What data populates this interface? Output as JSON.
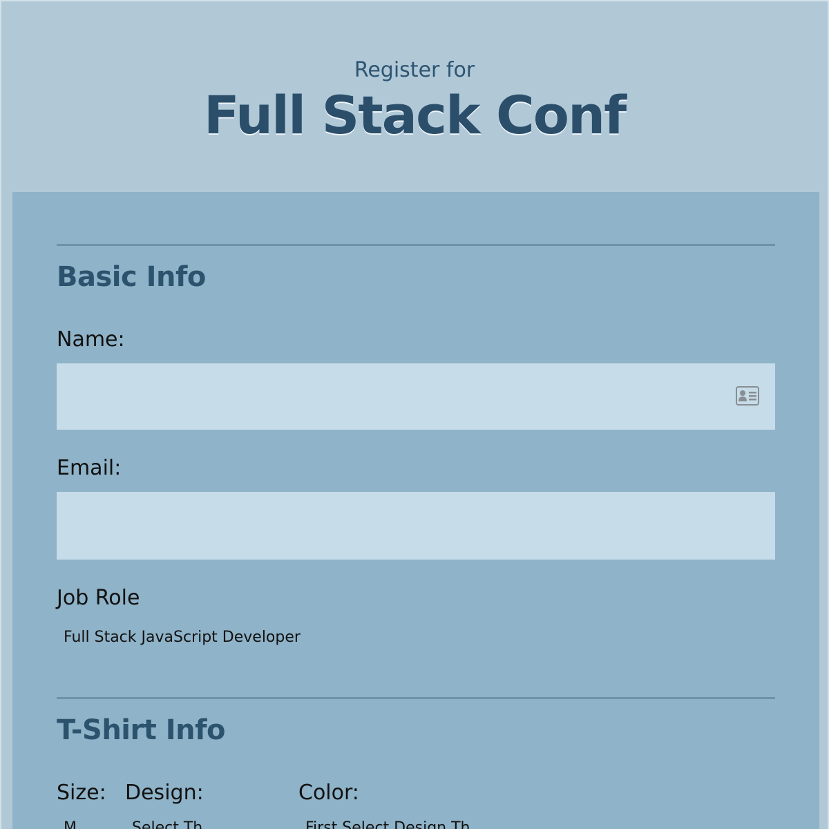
{
  "header": {
    "subtitle": "Register for",
    "title": "Full Stack Conf"
  },
  "basic_info": {
    "heading": "Basic Info",
    "name_label": "Name:",
    "name_value": "",
    "name_icon": "contact-card-icon",
    "email_label": "Email:",
    "email_value": "",
    "job_role_label": "Job Role",
    "job_role_selected": "Full Stack JavaScript Developer"
  },
  "tshirt_info": {
    "heading": "T-Shirt Info",
    "size_label": "Size:",
    "design_label": "Design:",
    "color_label": "Color:",
    "size_value": "M",
    "design_value": "Select Th",
    "color_value": "First Select Design Th"
  },
  "colors": {
    "page_bg": "#b1c8d7",
    "card_bg": "#8fb3c8",
    "input_bg": "#c6dce9",
    "heading": "#2b536e"
  }
}
